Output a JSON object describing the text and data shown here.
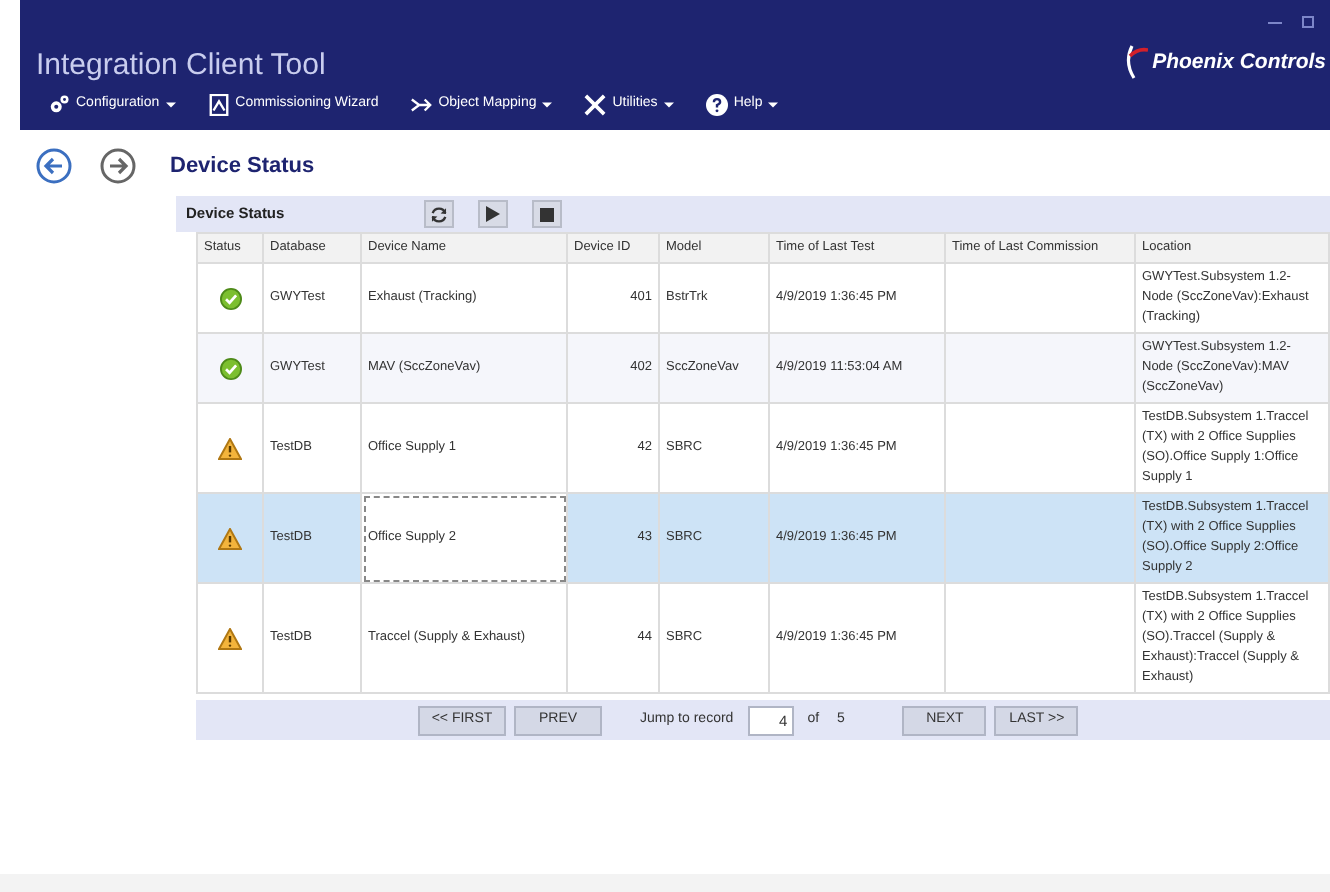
{
  "window": {
    "title": "Integration Client Tool",
    "logo": "Phoenix Controls"
  },
  "menu": [
    {
      "label": "Configuration",
      "dropdown": true
    },
    {
      "label": "Commissioning Wizard",
      "dropdown": false
    },
    {
      "label": "Object Mapping",
      "dropdown": true
    },
    {
      "label": "Utilities",
      "dropdown": true
    },
    {
      "label": "Help",
      "dropdown": true
    }
  ],
  "page": {
    "title": "Device Status"
  },
  "grid": {
    "title": "Device Status",
    "columns": [
      "Status",
      "Database",
      "Device Name",
      "Device ID",
      "Model",
      "Time of Last Test",
      "Time of Last Commission",
      "Location"
    ],
    "rows": [
      {
        "kind": "ok",
        "selected": false,
        "database": "GWYTest",
        "device_name": "Exhaust (Tracking)",
        "device_id": "401",
        "model": "BstrTrk",
        "last_test": "4/9/2019 1:36:45 PM",
        "last_commission": "",
        "location": "GWYTest.Subsystem 1.2-Node (SccZoneVav):Exhaust (Tracking)"
      },
      {
        "kind": "ok",
        "selected": false,
        "database": "GWYTest",
        "device_name": "MAV (SccZoneVav)",
        "device_id": "402",
        "model": "SccZoneVav",
        "last_test": "4/9/2019 11:53:04 AM",
        "last_commission": "",
        "location": "GWYTest.Subsystem 1.2-Node (SccZoneVav):MAV (SccZoneVav)"
      },
      {
        "kind": "warning",
        "selected": false,
        "database": "TestDB",
        "device_name": "Office Supply 1",
        "device_id": "42",
        "model": "SBRC",
        "last_test": "4/9/2019 1:36:45 PM",
        "last_commission": "",
        "location": "TestDB.Subsystem 1.Traccel (TX) with 2 Office Supplies (SO).Office Supply 1:Office Supply 1"
      },
      {
        "kind": "warning",
        "selected": true,
        "database": "TestDB",
        "device_name": "Office Supply 2",
        "device_id": "43",
        "model": "SBRC",
        "last_test": "4/9/2019 1:36:45 PM",
        "last_commission": "",
        "location": "TestDB.Subsystem 1.Traccel (TX) with 2 Office Supplies (SO).Office Supply 2:Office Supply 2"
      },
      {
        "kind": "warning",
        "selected": false,
        "database": "TestDB",
        "device_name": "Traccel (Supply & Exhaust)",
        "device_id": "44",
        "model": "SBRC",
        "last_test": "4/9/2019 1:36:45 PM",
        "last_commission": "",
        "location": "TestDB.Subsystem 1.Traccel (TX) with 2 Office Supplies (SO).Traccel (Supply & Exhaust):Traccel (Supply & Exhaust)"
      }
    ]
  },
  "pager": {
    "first": "<< FIRST",
    "prev": "PREV",
    "jump_label": "Jump to record",
    "record": "4",
    "of": "of",
    "total": "5",
    "next": "NEXT",
    "last": "LAST >>"
  }
}
